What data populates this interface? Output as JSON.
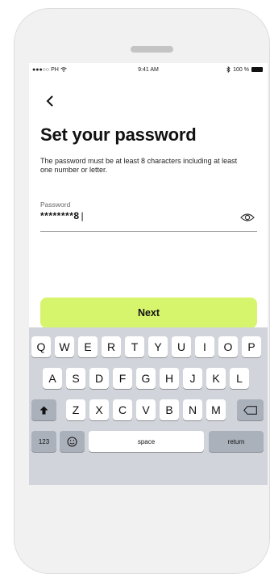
{
  "status_bar": {
    "carrier": "PH",
    "time": "9:41 AM",
    "battery": "100 %"
  },
  "page": {
    "title": "Set your password",
    "subtitle": "The password must be at least 8 characters including at least one number or letter."
  },
  "password_field": {
    "label": "Password",
    "value": "********8",
    "caret": "|"
  },
  "next_button": {
    "label": "Next"
  },
  "keyboard": {
    "row1": [
      "Q",
      "W",
      "E",
      "R",
      "T",
      "Y",
      "U",
      "I",
      "O",
      "P"
    ],
    "row2": [
      "A",
      "S",
      "D",
      "F",
      "G",
      "H",
      "J",
      "K",
      "L"
    ],
    "row3": [
      "Z",
      "X",
      "C",
      "V",
      "B",
      "N",
      "M"
    ],
    "numbers_key": "123",
    "space_key": "space",
    "return_key": "return"
  }
}
